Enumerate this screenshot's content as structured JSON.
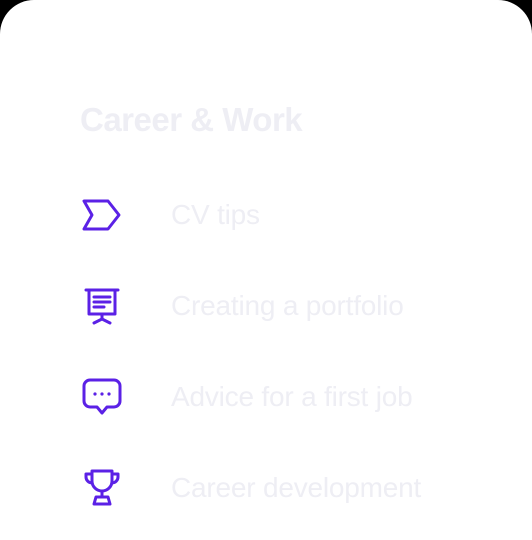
{
  "section": {
    "title": "Career & Work"
  },
  "menu": {
    "items": [
      {
        "label": "CV tips",
        "icon": "chevron-tag-icon"
      },
      {
        "label": "Creating a portfolio",
        "icon": "presentation-board-icon"
      },
      {
        "label": "Advice for a first job",
        "icon": "chat-bubble-icon"
      },
      {
        "label": "Career development",
        "icon": "trophy-icon"
      }
    ]
  },
  "colors": {
    "icon_accent": "#5b21e6",
    "text_muted": "#eeeef4",
    "card_background": "#ffffff"
  }
}
